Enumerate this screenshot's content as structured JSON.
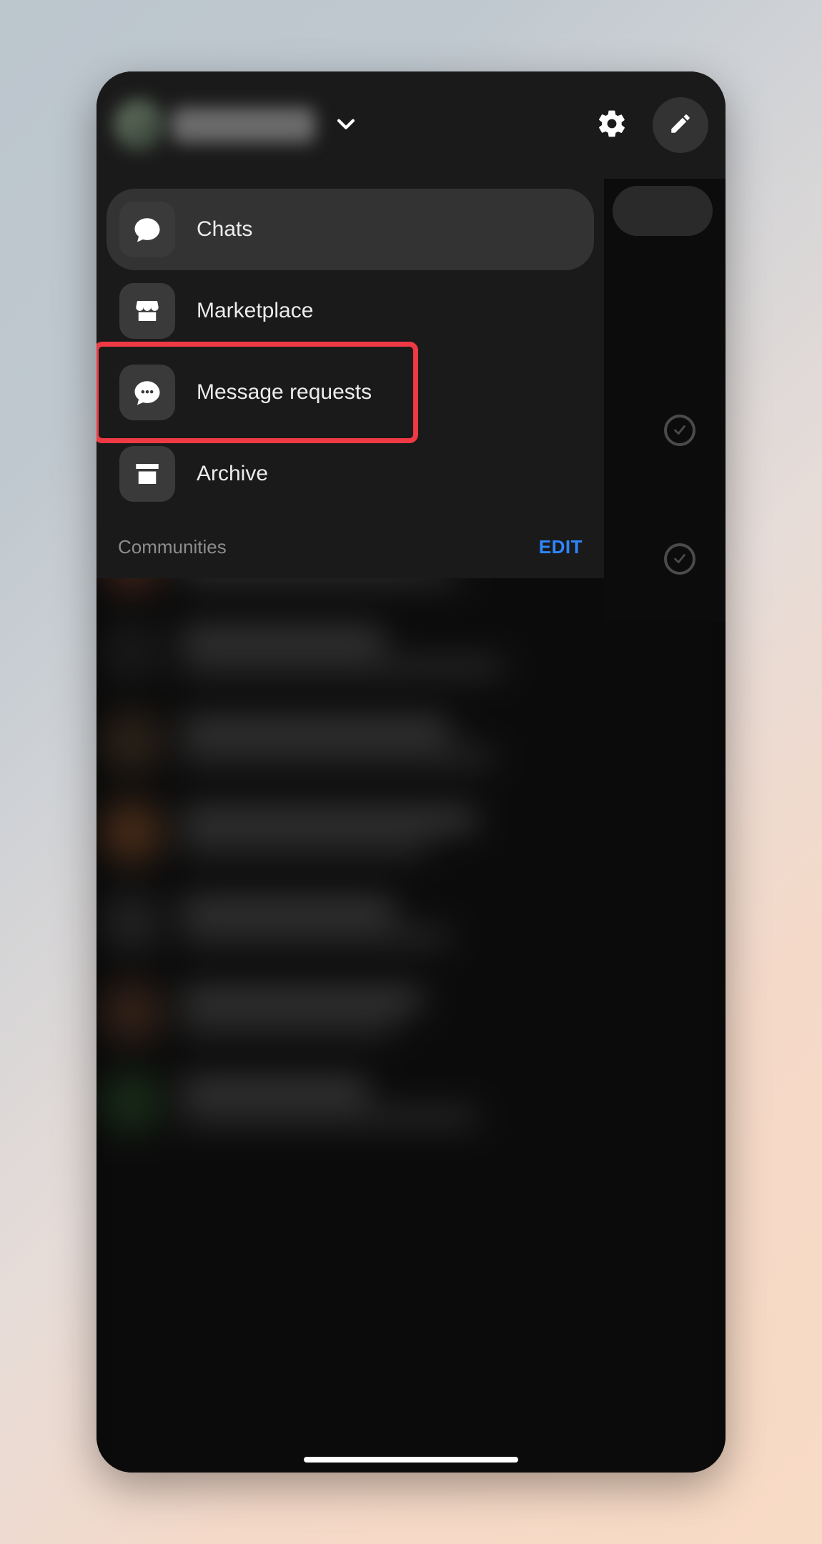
{
  "header": {
    "settings_icon": "gear",
    "compose_icon": "pencil"
  },
  "menu": {
    "items": [
      {
        "id": "chats",
        "label": "Chats",
        "icon": "chat-bubble",
        "active": true
      },
      {
        "id": "marketplace",
        "label": "Marketplace",
        "icon": "storefront",
        "active": false
      },
      {
        "id": "message-requests",
        "label": "Message requests",
        "icon": "chat-ellipsis",
        "active": false,
        "highlighted": true
      },
      {
        "id": "archive",
        "label": "Archive",
        "icon": "archive-box",
        "active": false
      }
    ]
  },
  "section": {
    "communities_label": "Communities",
    "edit_label": "EDIT"
  },
  "colors": {
    "panel_bg": "#1a1a1a",
    "item_active_bg": "#333333",
    "icon_bg": "#3a3a3a",
    "text": "#ececec",
    "muted": "#8d8d8d",
    "accent_link": "#2f87ff",
    "highlight_border": "#ef3a45"
  }
}
